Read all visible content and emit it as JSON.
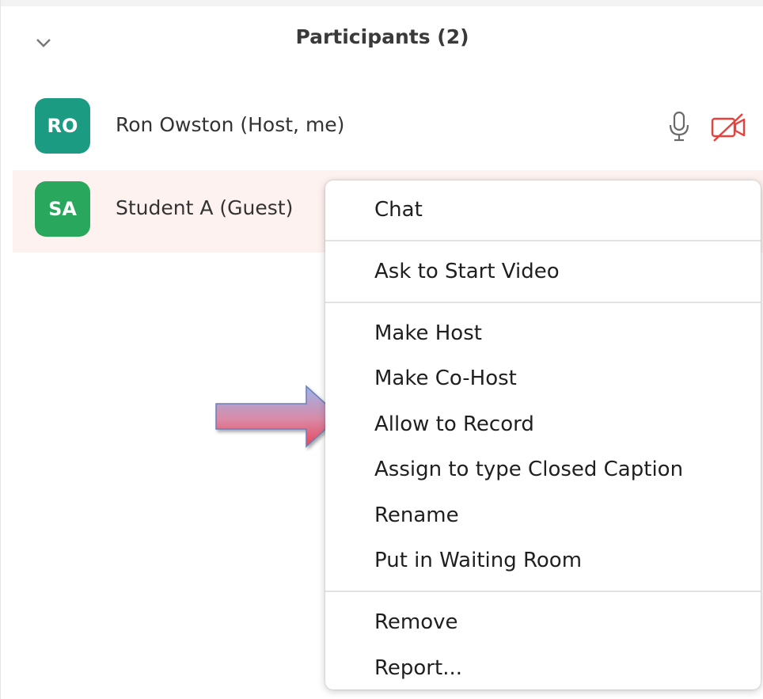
{
  "header": {
    "title": "Participants (2)",
    "collapse_icon": "chevron-down-icon"
  },
  "participants": [
    {
      "initials": "RO",
      "name": "Ron Owston (Host, me)",
      "avatar_color": "#1a9b82",
      "mic_icon": "microphone-icon",
      "video_icon": "video-off-icon",
      "video_off_color": "#e8413c"
    },
    {
      "initials": "SA",
      "name": "Student A (Guest)",
      "avatar_color": "#29a75c",
      "row_highlight": "#fdf2ef"
    }
  ],
  "context_menu": {
    "items": [
      {
        "label": "Chat"
      },
      {
        "label": "Ask to Start Video"
      },
      {
        "label": "Make Host"
      },
      {
        "label": "Make Co-Host"
      },
      {
        "label": "Allow to Record"
      },
      {
        "label": "Assign to type Closed Caption"
      },
      {
        "label": "Rename"
      },
      {
        "label": "Put in Waiting Room"
      },
      {
        "label": "Remove"
      },
      {
        "label": "Report..."
      }
    ]
  },
  "annotation": {
    "arrow_icon": "pointer-arrow-icon",
    "points_to": "Allow to Record"
  }
}
